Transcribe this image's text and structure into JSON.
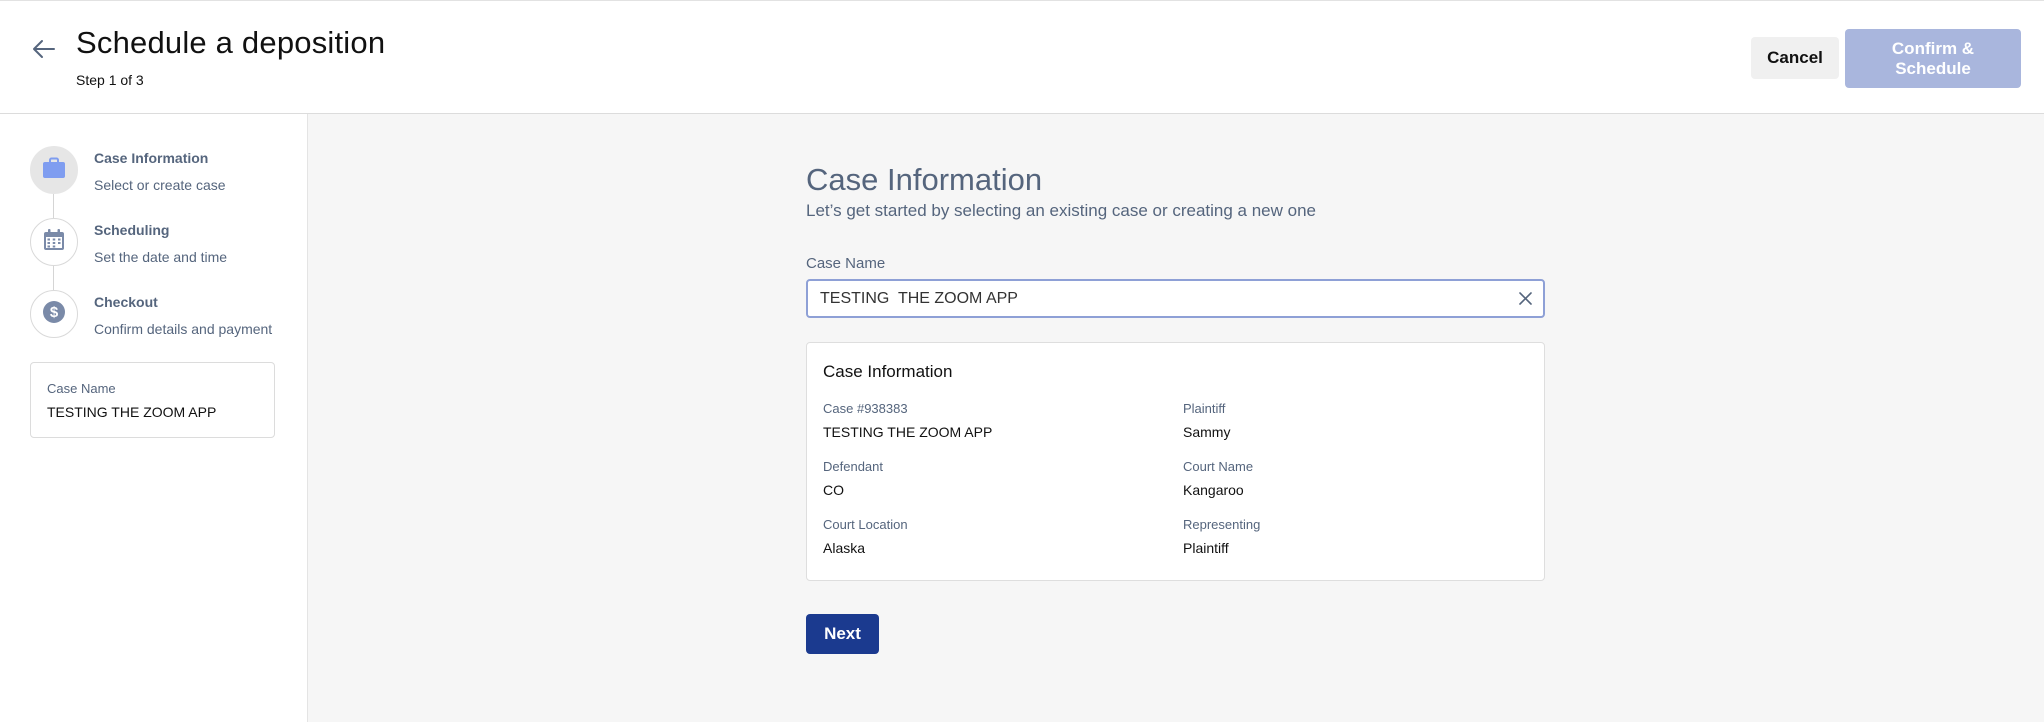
{
  "header": {
    "title": "Schedule a deposition",
    "step": "Step 1 of 3",
    "cancel_label": "Cancel",
    "confirm_label": "Confirm & Schedule"
  },
  "sidebar": {
    "steps": [
      {
        "title": "Case Information",
        "subtitle": "Select or create case",
        "icon": "briefcase-icon",
        "active": true
      },
      {
        "title": "Scheduling",
        "subtitle": "Set the date and time",
        "icon": "calendar-icon",
        "active": false
      },
      {
        "title": "Checkout",
        "subtitle": "Confirm details and payment",
        "icon": "dollar-icon",
        "active": false
      }
    ],
    "case_card": {
      "label": "Case Name",
      "value": "TESTING THE ZOOM APP"
    }
  },
  "main": {
    "title": "Case Information",
    "subtitle": "Let’s get started by selecting an existing case or creating a new one",
    "case_name_label": "Case Name",
    "case_name_value": "TESTING  THE ZOOM APP",
    "panel": {
      "title": "Case Information",
      "fields": [
        {
          "label": "Case #938383",
          "value": "TESTING THE ZOOM APP"
        },
        {
          "label": "Plaintiff",
          "value": "Sammy"
        },
        {
          "label": "Defendant",
          "value": "CO"
        },
        {
          "label": "Court Name",
          "value": "Kangaroo"
        },
        {
          "label": "Court Location",
          "value": "Alaska"
        },
        {
          "label": "Representing",
          "value": "Plaintiff"
        }
      ]
    },
    "next_label": "Next"
  },
  "colors": {
    "accent": "#1b3a8f",
    "confirm_disabled": "#a9b6dd",
    "muted_text": "#55657d",
    "step_icon": "#7a8aa8",
    "active_icon": "#7f9df0"
  }
}
